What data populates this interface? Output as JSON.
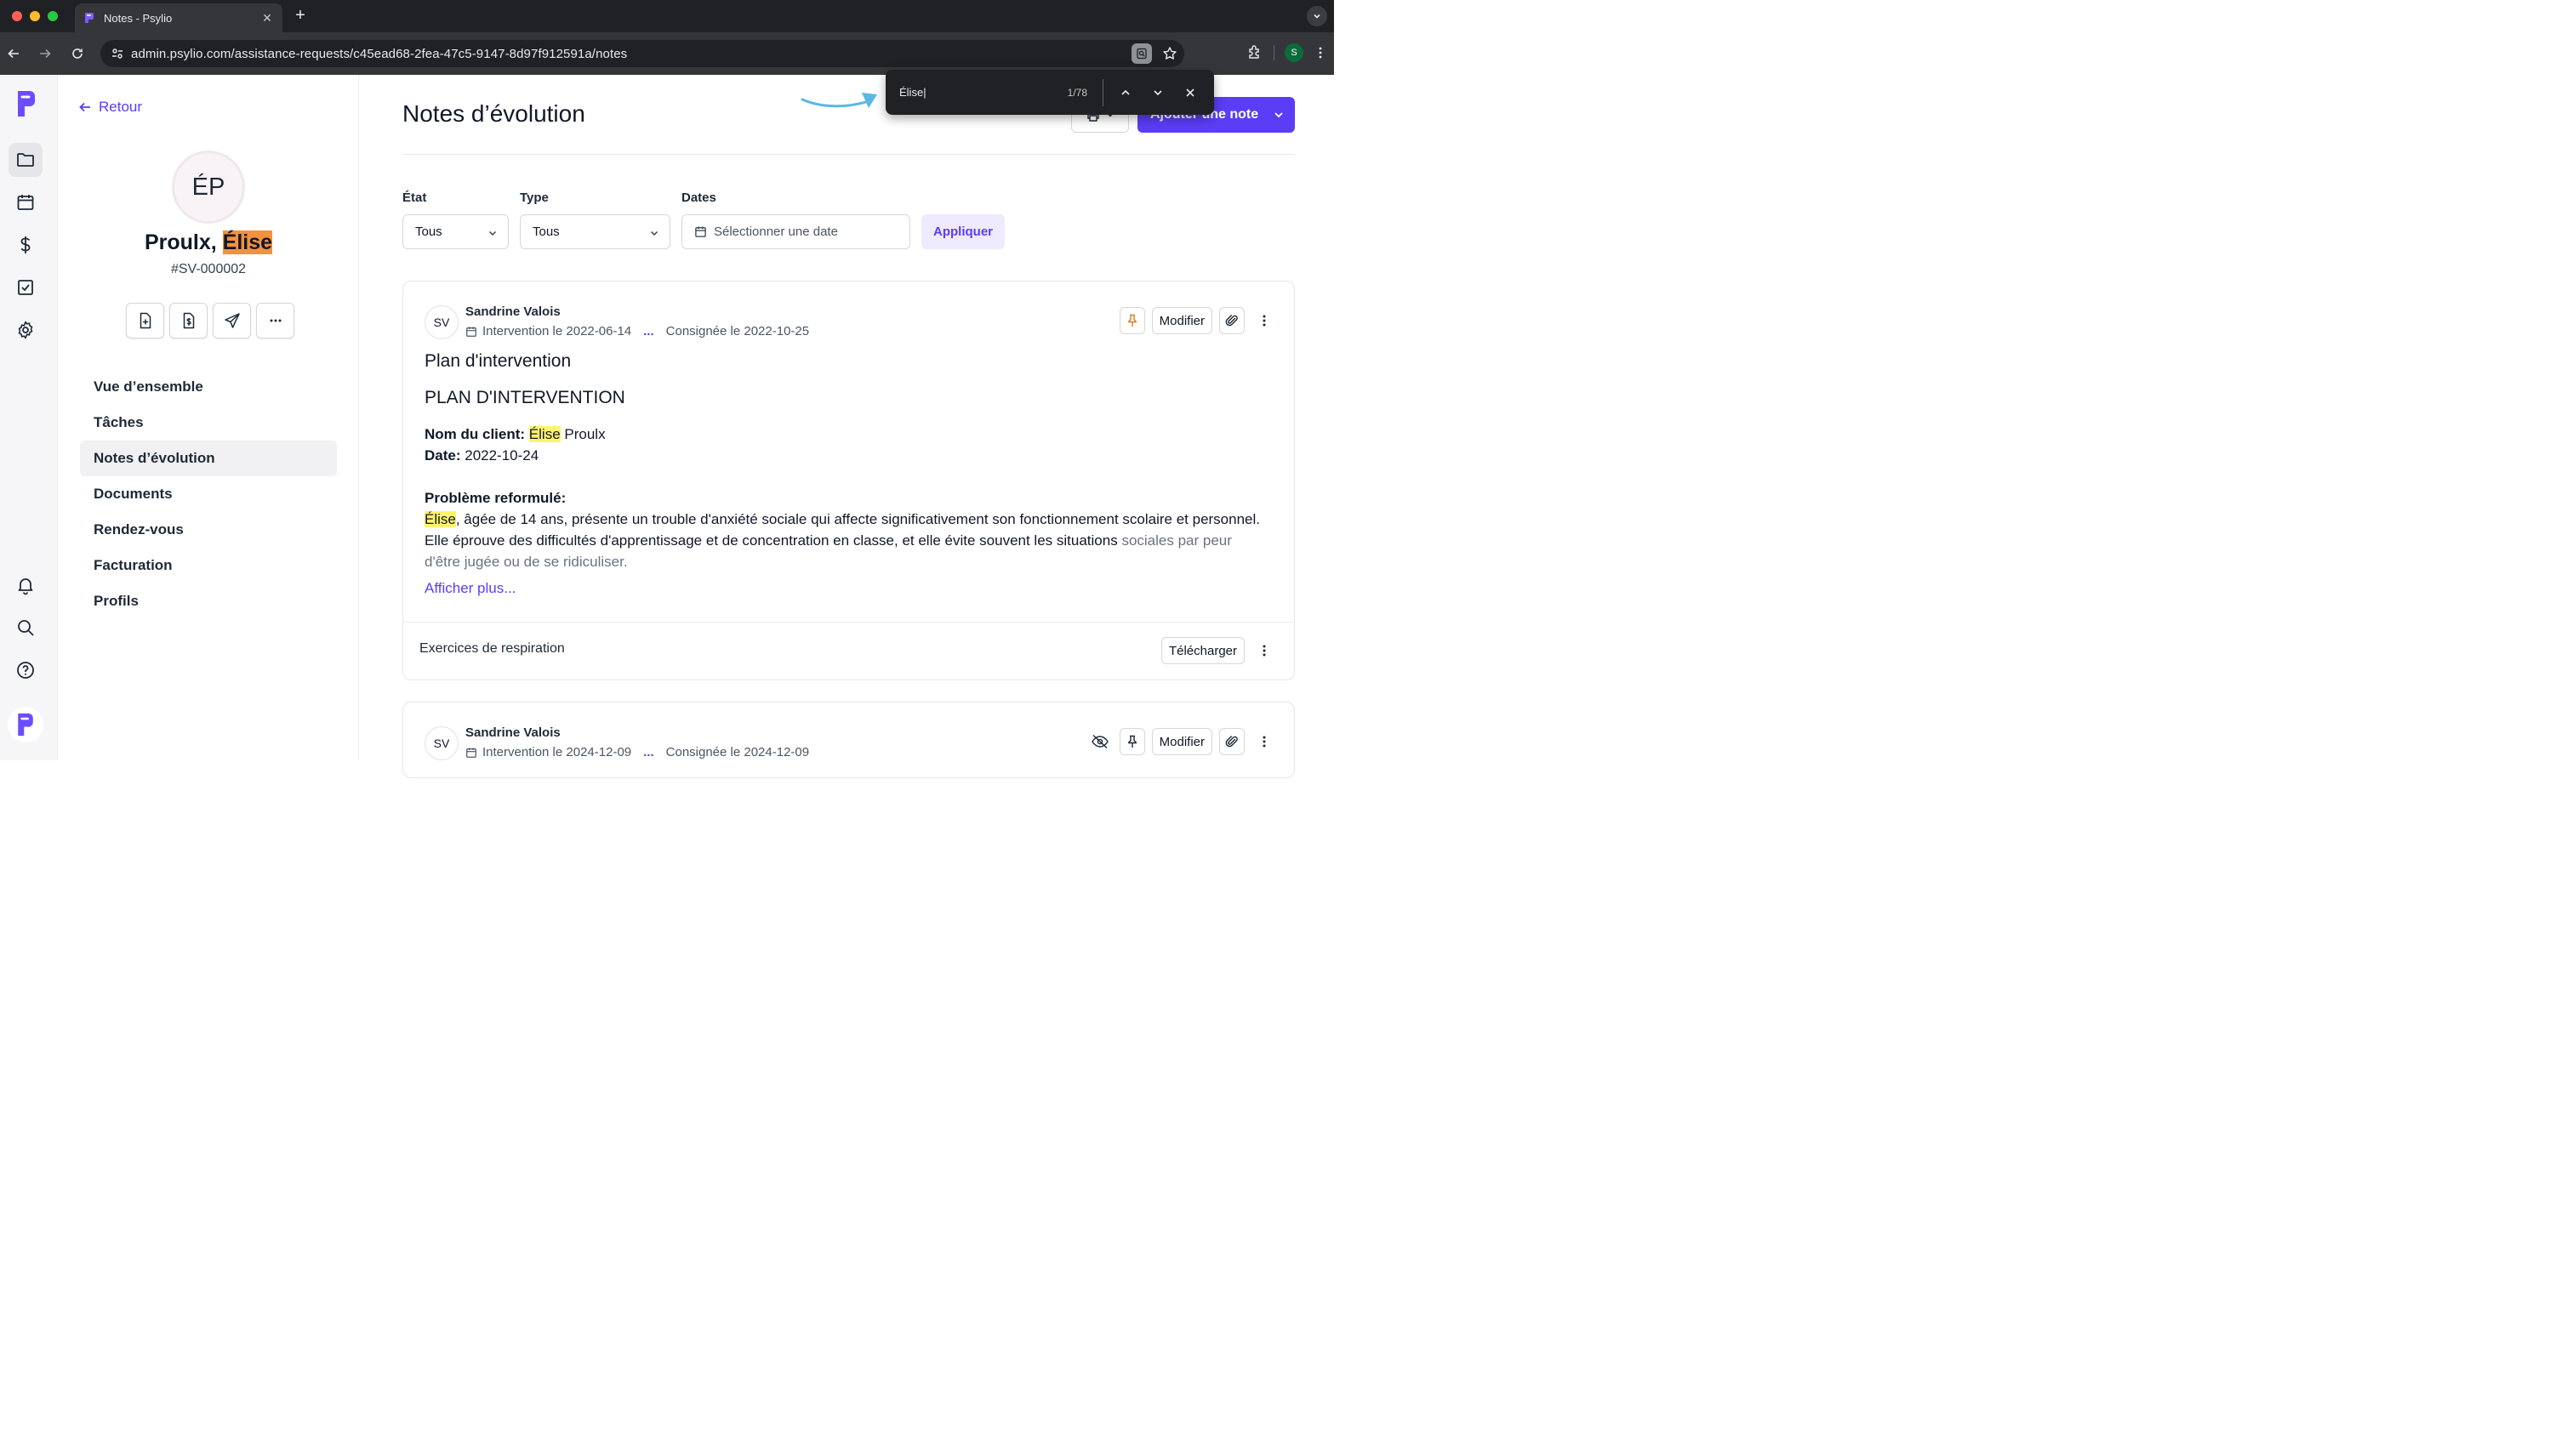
{
  "browser": {
    "tab_title": "Notes - Psylio",
    "url": "admin.psylio.com/assistance-requests/c45ead68-2fea-47c5-9147-8d97f912591a/notes",
    "profile_initial": "S",
    "find_query": "Élise",
    "find_count": "1/78"
  },
  "colors": {
    "brand": "#5b3df5",
    "highlight_current": "#f4913e",
    "highlight": "#fff36b"
  },
  "rail": {
    "icons": [
      "folder-icon",
      "calendar-icon",
      "dollar-icon",
      "checkbox-icon",
      "gear-icon",
      "bell-icon",
      "search-icon",
      "help-icon"
    ]
  },
  "client": {
    "back_label": "Retour",
    "initials": "ÉP",
    "last_name": "Proulx, ",
    "first_name": "Élise",
    "id": "#SV-000002",
    "nav": [
      "Vue d’ensemble",
      "Tâches",
      "Notes d’évolution",
      "Documents",
      "Rendez-vous",
      "Facturation",
      "Profils"
    ],
    "active_nav": "Notes d’évolution"
  },
  "main": {
    "title": "Notes d’évolution",
    "add_note_label": "Ajouter une note",
    "filters": {
      "state_label": "État",
      "state_value": "Tous",
      "type_label": "Type",
      "type_value": "Tous",
      "dates_label": "Dates",
      "dates_placeholder": "Sélectionner une date",
      "apply_label": "Appliquer"
    },
    "notes": [
      {
        "author_initials": "SV",
        "author": "Sandrine Valois",
        "intervention": "Intervention le 2022-06-14",
        "ellipsis": "...",
        "recorded": "Consignée le 2022-10-25",
        "edit_label": "Modifier",
        "title": "Plan d'intervention",
        "body_heading": "PLAN D'INTERVENTION",
        "client_label": "Nom du client:",
        "client_first": "Élise",
        "client_last": " Proulx",
        "date_label": "Date:",
        "date_value": " 2022-10-24",
        "problem_label": "Problème reformulé:",
        "problem_first": "Élise",
        "problem_text": ", âgée de 14 ans, présente un trouble d'anxiété sociale qui affecte significativement son fonctionnement scolaire et personnel. Elle éprouve des difficultés d'apprentissage et de concentration en classe, et elle évite souvent les situations",
        "problem_faded": "sociales par peur d'être jugée ou de se ridiculiser.",
        "show_more": "Afficher plus...",
        "attachment": "Exercices de respiration",
        "download_label": "Télécharger"
      },
      {
        "author_initials": "SV",
        "author": "Sandrine Valois",
        "intervention": "Intervention le 2024-12-09",
        "ellipsis": "...",
        "recorded": "Consignée le 2024-12-09",
        "edit_label": "Modifier"
      }
    ]
  }
}
